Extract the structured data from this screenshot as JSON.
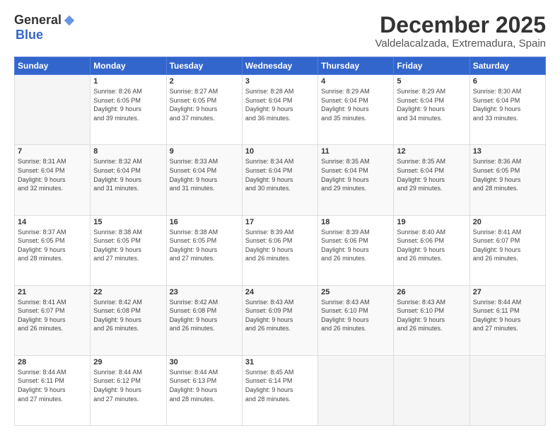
{
  "header": {
    "logo_general": "General",
    "logo_blue": "Blue",
    "month_title": "December 2025",
    "location": "Valdelacalzada, Extremadura, Spain"
  },
  "days_of_week": [
    "Sunday",
    "Monday",
    "Tuesday",
    "Wednesday",
    "Thursday",
    "Friday",
    "Saturday"
  ],
  "weeks": [
    [
      {
        "day": "",
        "info": ""
      },
      {
        "day": "1",
        "info": "Sunrise: 8:26 AM\nSunset: 6:05 PM\nDaylight: 9 hours\nand 39 minutes."
      },
      {
        "day": "2",
        "info": "Sunrise: 8:27 AM\nSunset: 6:05 PM\nDaylight: 9 hours\nand 37 minutes."
      },
      {
        "day": "3",
        "info": "Sunrise: 8:28 AM\nSunset: 6:04 PM\nDaylight: 9 hours\nand 36 minutes."
      },
      {
        "day": "4",
        "info": "Sunrise: 8:29 AM\nSunset: 6:04 PM\nDaylight: 9 hours\nand 35 minutes."
      },
      {
        "day": "5",
        "info": "Sunrise: 8:29 AM\nSunset: 6:04 PM\nDaylight: 9 hours\nand 34 minutes."
      },
      {
        "day": "6",
        "info": "Sunrise: 8:30 AM\nSunset: 6:04 PM\nDaylight: 9 hours\nand 33 minutes."
      }
    ],
    [
      {
        "day": "7",
        "info": "Sunrise: 8:31 AM\nSunset: 6:04 PM\nDaylight: 9 hours\nand 32 minutes."
      },
      {
        "day": "8",
        "info": "Sunrise: 8:32 AM\nSunset: 6:04 PM\nDaylight: 9 hours\nand 31 minutes."
      },
      {
        "day": "9",
        "info": "Sunrise: 8:33 AM\nSunset: 6:04 PM\nDaylight: 9 hours\nand 31 minutes."
      },
      {
        "day": "10",
        "info": "Sunrise: 8:34 AM\nSunset: 6:04 PM\nDaylight: 9 hours\nand 30 minutes."
      },
      {
        "day": "11",
        "info": "Sunrise: 8:35 AM\nSunset: 6:04 PM\nDaylight: 9 hours\nand 29 minutes."
      },
      {
        "day": "12",
        "info": "Sunrise: 8:35 AM\nSunset: 6:04 PM\nDaylight: 9 hours\nand 29 minutes."
      },
      {
        "day": "13",
        "info": "Sunrise: 8:36 AM\nSunset: 6:05 PM\nDaylight: 9 hours\nand 28 minutes."
      }
    ],
    [
      {
        "day": "14",
        "info": "Sunrise: 8:37 AM\nSunset: 6:05 PM\nDaylight: 9 hours\nand 28 minutes."
      },
      {
        "day": "15",
        "info": "Sunrise: 8:38 AM\nSunset: 6:05 PM\nDaylight: 9 hours\nand 27 minutes."
      },
      {
        "day": "16",
        "info": "Sunrise: 8:38 AM\nSunset: 6:05 PM\nDaylight: 9 hours\nand 27 minutes."
      },
      {
        "day": "17",
        "info": "Sunrise: 8:39 AM\nSunset: 6:06 PM\nDaylight: 9 hours\nand 26 minutes."
      },
      {
        "day": "18",
        "info": "Sunrise: 8:39 AM\nSunset: 6:06 PM\nDaylight: 9 hours\nand 26 minutes."
      },
      {
        "day": "19",
        "info": "Sunrise: 8:40 AM\nSunset: 6:06 PM\nDaylight: 9 hours\nand 26 minutes."
      },
      {
        "day": "20",
        "info": "Sunrise: 8:41 AM\nSunset: 6:07 PM\nDaylight: 9 hours\nand 26 minutes."
      }
    ],
    [
      {
        "day": "21",
        "info": "Sunrise: 8:41 AM\nSunset: 6:07 PM\nDaylight: 9 hours\nand 26 minutes."
      },
      {
        "day": "22",
        "info": "Sunrise: 8:42 AM\nSunset: 6:08 PM\nDaylight: 9 hours\nand 26 minutes."
      },
      {
        "day": "23",
        "info": "Sunrise: 8:42 AM\nSunset: 6:08 PM\nDaylight: 9 hours\nand 26 minutes."
      },
      {
        "day": "24",
        "info": "Sunrise: 8:43 AM\nSunset: 6:09 PM\nDaylight: 9 hours\nand 26 minutes."
      },
      {
        "day": "25",
        "info": "Sunrise: 8:43 AM\nSunset: 6:10 PM\nDaylight: 9 hours\nand 26 minutes."
      },
      {
        "day": "26",
        "info": "Sunrise: 8:43 AM\nSunset: 6:10 PM\nDaylight: 9 hours\nand 26 minutes."
      },
      {
        "day": "27",
        "info": "Sunrise: 8:44 AM\nSunset: 6:11 PM\nDaylight: 9 hours\nand 27 minutes."
      }
    ],
    [
      {
        "day": "28",
        "info": "Sunrise: 8:44 AM\nSunset: 6:11 PM\nDaylight: 9 hours\nand 27 minutes."
      },
      {
        "day": "29",
        "info": "Sunrise: 8:44 AM\nSunset: 6:12 PM\nDaylight: 9 hours\nand 27 minutes."
      },
      {
        "day": "30",
        "info": "Sunrise: 8:44 AM\nSunset: 6:13 PM\nDaylight: 9 hours\nand 28 minutes."
      },
      {
        "day": "31",
        "info": "Sunrise: 8:45 AM\nSunset: 6:14 PM\nDaylight: 9 hours\nand 28 minutes."
      },
      {
        "day": "",
        "info": ""
      },
      {
        "day": "",
        "info": ""
      },
      {
        "day": "",
        "info": ""
      }
    ]
  ]
}
